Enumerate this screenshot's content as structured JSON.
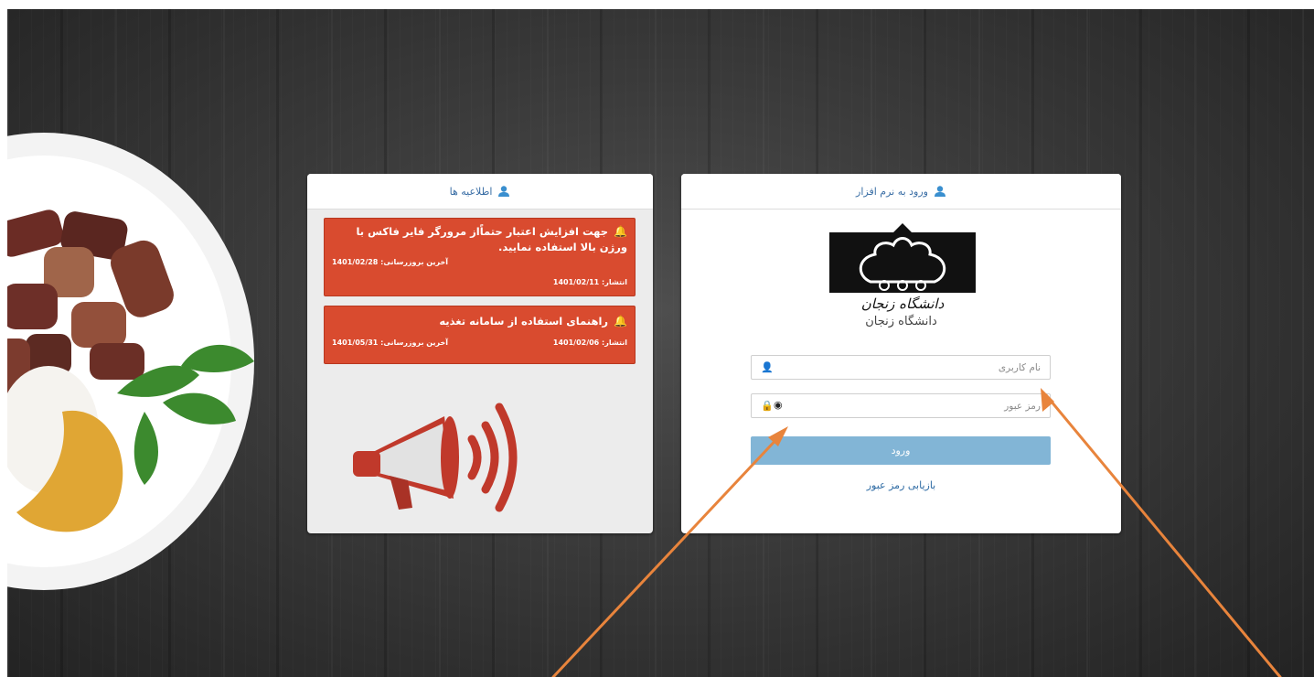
{
  "news": {
    "header_title": "اطلاعیه ها",
    "items": [
      {
        "title": "جهت افزایش اعتبار حتماًاز مرورگر فایر فاکس با ورژن بالا استفاده نمایید.",
        "updated": "آخرین بروزرسانی: 1401/02/28",
        "published": "انتشار: 1401/02/11"
      },
      {
        "title": "راهنمای استفاده از سامانه تغذیه",
        "updated": "آخرین بروزرسانی: 1401/05/31",
        "published": "انتشار: 1401/02/06"
      }
    ]
  },
  "login": {
    "header_title": "ورود به نرم افزار",
    "university_name": "دانشگاه زنجان",
    "logo_text": "دانشگاه زنجان",
    "username_placeholder": "نام کاربری",
    "password_placeholder": "رمز عبور",
    "login_button": "ورود",
    "forgot_link": "بازیابی رمز عبور"
  },
  "colors": {
    "notice_bg": "#d94b2f",
    "login_button_bg": "#82b5d6",
    "header_text": "#3a6ea5",
    "annotation_arrow": "#e8843c"
  },
  "icons": {
    "header": "user-icon",
    "notice": "bell-icon",
    "username": "user-icon",
    "password": "lock-icon",
    "show_password": "eye-slash-icon"
  }
}
